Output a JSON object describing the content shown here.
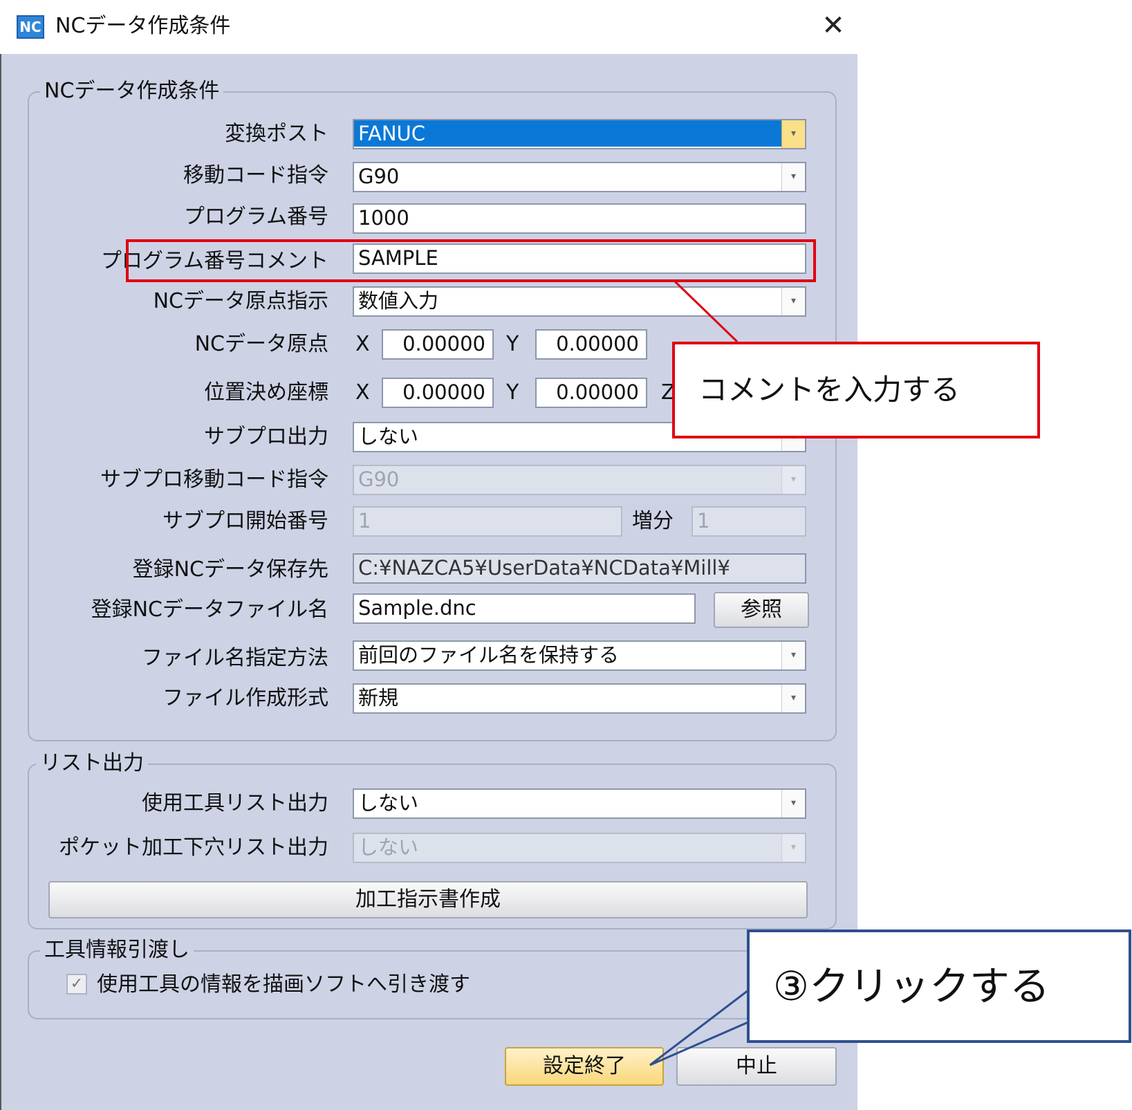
{
  "window": {
    "icon_text": "NC",
    "title": "NCデータ作成条件",
    "close_glyph": "✕"
  },
  "group_nc": {
    "legend": "NCデータ作成条件",
    "post_label": "変換ポスト",
    "post_value": "FANUC",
    "move_code_label": "移動コード指令",
    "move_code_value": "G90",
    "program_no_label": "プログラム番号",
    "program_no_value": "1000",
    "program_comment_label": "プログラム番号コメント",
    "program_comment_value": "SAMPLE",
    "origin_mode_label": "NCデータ原点指示",
    "origin_mode_value": "数値入力",
    "origin_label": "NCデータ原点",
    "origin_x_label": "X",
    "origin_x": "0.00000",
    "origin_y_label": "Y",
    "origin_y": "0.00000",
    "position_label": "位置決め座標",
    "position_x_label": "X",
    "position_x": "0.00000",
    "position_y_label": "Y",
    "position_y": "0.00000",
    "position_z_label_partial": "Z",
    "subpro_output_label": "サブプロ出力",
    "subpro_output_value": "しない",
    "subpro_move_label": "サブプロ移動コード指令",
    "subpro_move_value": "G90",
    "subpro_start_label": "サブプロ開始番号",
    "subpro_start_value": "1",
    "increment_label": "増分",
    "increment_value": "1",
    "save_dir_label": "登録NCデータ保存先",
    "save_dir_value": "C:¥NAZCA5¥UserData¥NCData¥Mill¥",
    "filename_label": "登録NCデータファイル名",
    "filename_value": "Sample.dnc",
    "browse_button": "参照",
    "filename_method_label": "ファイル名指定方法",
    "filename_method_value": "前回のファイル名を保持する",
    "file_format_label": "ファイル作成形式",
    "file_format_value": "新規"
  },
  "group_list": {
    "legend": "リスト出力",
    "tool_list_label": "使用工具リスト出力",
    "tool_list_value": "しない",
    "pocket_list_label": "ポケット加工下穴リスト出力",
    "pocket_list_value": "しない",
    "instruction_button": "加工指示書作成"
  },
  "group_tool": {
    "legend": "工具情報引渡し",
    "checkbox_label": "使用工具の情報を描画ソフトへ引き渡す",
    "checked": true
  },
  "footer": {
    "ok_button": "設定終了",
    "cancel_button": "中止"
  },
  "annotations": {
    "comment_callout": "コメントを入力する",
    "click_callout": "③クリックする",
    "red": "#e00012",
    "blue": "#2f4f8f"
  }
}
